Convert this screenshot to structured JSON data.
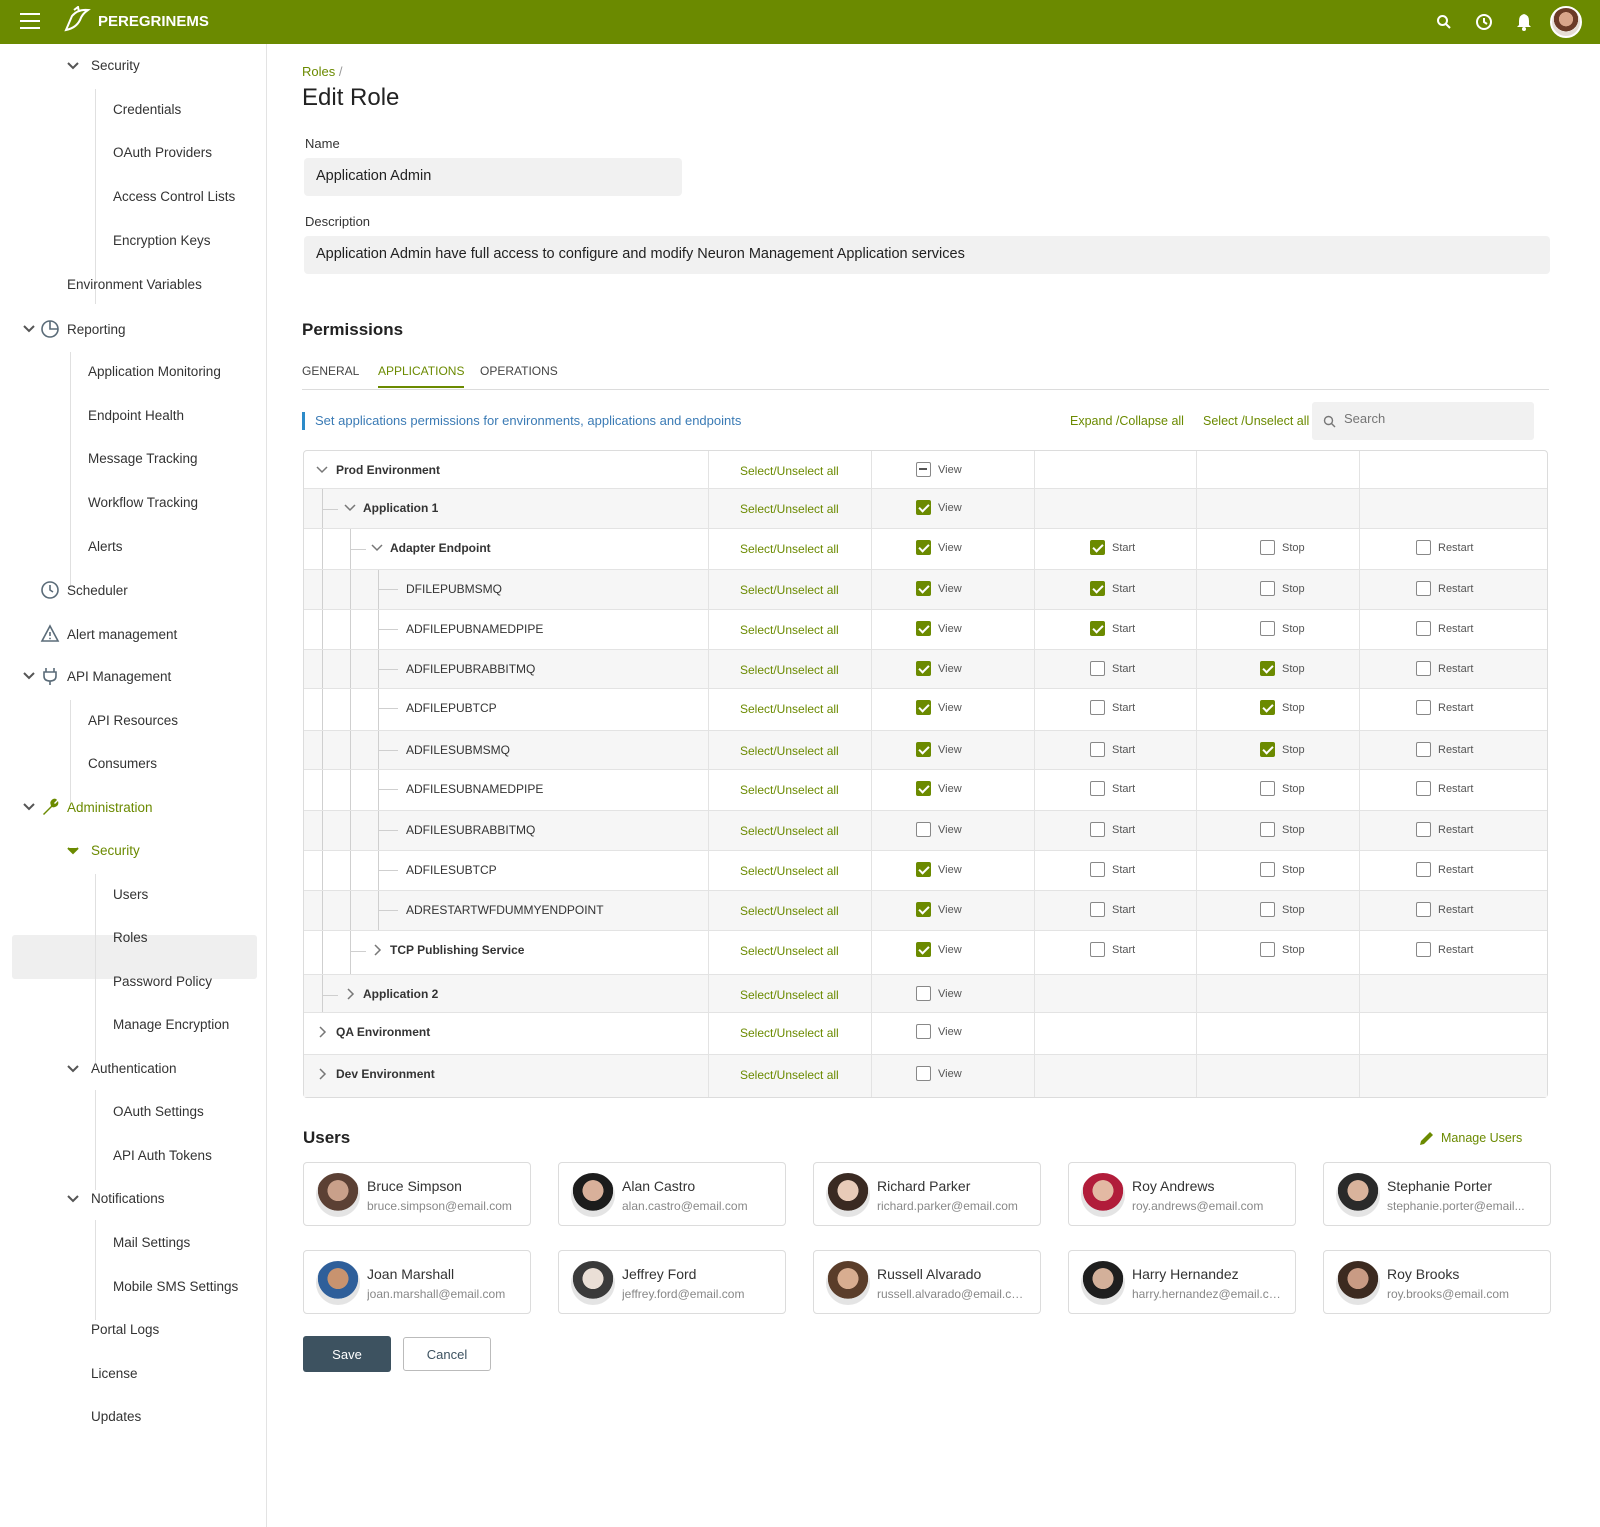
{
  "app": {
    "name": "PEREGRINEMS",
    "brand_color": "#6b8a00"
  },
  "sidebar": {
    "items": [
      {
        "label": "Security"
      },
      {
        "label": "Credentials"
      },
      {
        "label": "OAuth Providers"
      },
      {
        "label": "Access Control Lists"
      },
      {
        "label": "Encryption Keys"
      },
      {
        "label": "Environment Variables"
      },
      {
        "label": "Reporting"
      },
      {
        "label": "Application Monitoring"
      },
      {
        "label": "Endpoint Health"
      },
      {
        "label": "Message Tracking"
      },
      {
        "label": "Workflow Tracking"
      },
      {
        "label": "Alerts"
      },
      {
        "label": "Scheduler"
      },
      {
        "label": "Alert management"
      },
      {
        "label": "API Management"
      },
      {
        "label": "API Resources"
      },
      {
        "label": "Consumers"
      },
      {
        "label": "Administration"
      },
      {
        "label": "Security"
      },
      {
        "label": "Users"
      },
      {
        "label": "Roles"
      },
      {
        "label": "Password Policy"
      },
      {
        "label": "Manage Encryption"
      },
      {
        "label": "Authentication"
      },
      {
        "label": "OAuth Settings"
      },
      {
        "label": "API Auth Tokens"
      },
      {
        "label": "Notifications"
      },
      {
        "label": "Mail Settings"
      },
      {
        "label": "Mobile SMS Settings"
      },
      {
        "label": "Portal Logs"
      },
      {
        "label": "License"
      },
      {
        "label": "Updates"
      }
    ]
  },
  "breadcrumb": {
    "parent": "Roles",
    "sep": "/"
  },
  "page": {
    "title": "Edit Role"
  },
  "form": {
    "name_label": "Name",
    "name_value": "Application Admin",
    "desc_label": "Description",
    "desc_value": "Application Admin have full access to configure and modify Neuron Management Application services"
  },
  "permissions": {
    "title": "Permissions",
    "tabs": [
      "GENERAL",
      "APPLICATIONS",
      "OPERATIONS"
    ],
    "active_tab": "APPLICATIONS",
    "info": "Set applications permissions for environments, applications and endpoints",
    "expand_collapse": "Expand /Collapse all",
    "select_unselect": "Select /Unselect all",
    "search_placeholder": "Search",
    "row_select_label": "Select/Unselect all",
    "labels": {
      "view": "View",
      "start": "Start",
      "stop": "Stop",
      "restart": "Restart"
    },
    "rows": [
      {
        "name": "Prod Environment",
        "level": 0,
        "expanded": true,
        "view": "indeterminate"
      },
      {
        "name": "Application 1",
        "level": 1,
        "expanded": true,
        "view": true
      },
      {
        "name": "Adapter Endpoint",
        "level": 2,
        "expanded": true,
        "view": true,
        "start": true,
        "stop": false,
        "restart": false
      },
      {
        "name": "DFILEPUBMSMQ",
        "level": 3,
        "view": true,
        "start": true,
        "stop": false,
        "restart": false
      },
      {
        "name": "ADFILEPUBNAMEDPIPE",
        "level": 3,
        "view": true,
        "start": true,
        "stop": false,
        "restart": false
      },
      {
        "name": "ADFILEPUBRABBITMQ",
        "level": 3,
        "view": true,
        "start": false,
        "stop": true,
        "restart": false
      },
      {
        "name": "ADFILEPUBTCP",
        "level": 3,
        "view": true,
        "start": false,
        "stop": true,
        "restart": false
      },
      {
        "name": "ADFILESUBMSMQ",
        "level": 3,
        "view": true,
        "start": false,
        "stop": true,
        "restart": false
      },
      {
        "name": "ADFILESUBNAMEDPIPE",
        "level": 3,
        "view": true,
        "start": false,
        "stop": false,
        "restart": false
      },
      {
        "name": "ADFILESUBRABBITMQ",
        "level": 3,
        "view": false,
        "start": false,
        "stop": false,
        "restart": false
      },
      {
        "name": "ADFILESUBTCP",
        "level": 3,
        "view": true,
        "start": false,
        "stop": false,
        "restart": false
      },
      {
        "name": "ADRESTARTWFDUMMYENDPOINT",
        "level": 3,
        "view": true,
        "start": false,
        "stop": false,
        "restart": false
      },
      {
        "name": "TCP Publishing Service",
        "level": 2,
        "expanded": false,
        "view": true,
        "start": false,
        "stop": false,
        "restart": false
      },
      {
        "name": "Application 2",
        "level": 1,
        "expanded": false,
        "view": false
      },
      {
        "name": "QA Environment",
        "level": 0,
        "expanded": false,
        "view": false
      },
      {
        "name": "Dev Environment",
        "level": 0,
        "expanded": false,
        "view": false
      }
    ]
  },
  "users": {
    "title": "Users",
    "manage_label": "Manage Users",
    "list": [
      {
        "name": "Bruce Simpson",
        "email": "bruce.simpson@email.com"
      },
      {
        "name": "Alan Castro",
        "email": "alan.castro@email.com"
      },
      {
        "name": "Richard Parker",
        "email": "richard.parker@email.com"
      },
      {
        "name": "Roy Andrews",
        "email": "roy.andrews@email.com"
      },
      {
        "name": "Stephanie Porter",
        "email": "stephanie.porter@email..."
      },
      {
        "name": "Joan Marshall",
        "email": "joan.marshall@email.com"
      },
      {
        "name": "Jeffrey Ford",
        "email": "jeffrey.ford@email.com"
      },
      {
        "name": "Russell Alvarado",
        "email": "russell.alvarado@email.com"
      },
      {
        "name": "Harry Hernandez",
        "email": "harry.hernandez@email.com"
      },
      {
        "name": "Roy Brooks",
        "email": "roy.brooks@email.com"
      }
    ]
  },
  "actions": {
    "save": "Save",
    "cancel": "Cancel"
  }
}
